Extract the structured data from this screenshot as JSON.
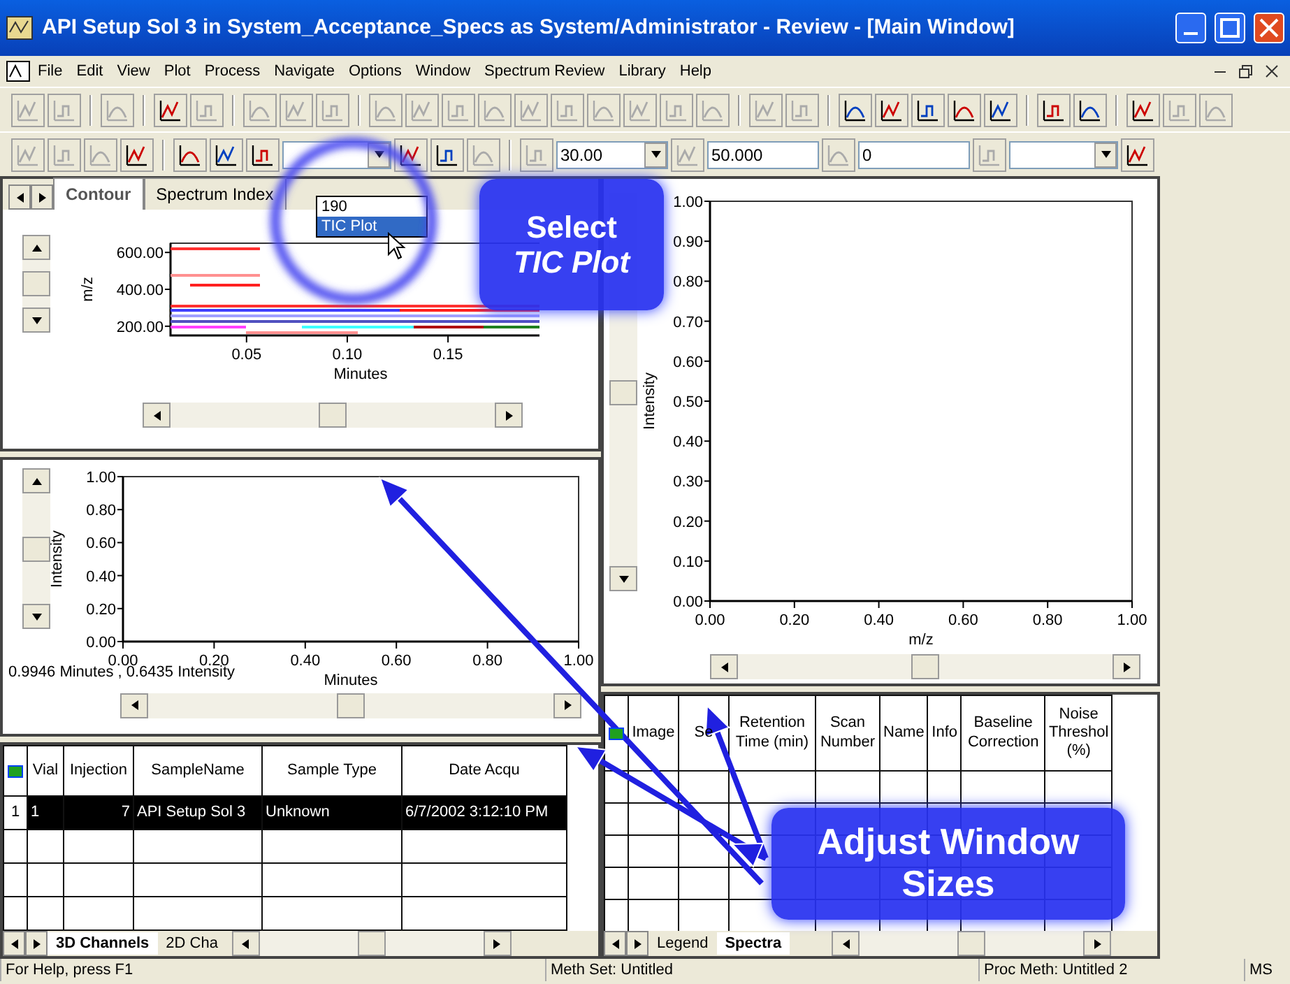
{
  "window": {
    "title": "API Setup Sol 3 in System_Acceptance_Specs as System/Administrator - Review - [Main Window]"
  },
  "menu": [
    "File",
    "Edit",
    "View",
    "Plot",
    "Process",
    "Navigate",
    "Options",
    "Window",
    "Spectrum Review",
    "Library",
    "Help"
  ],
  "toolbar_1": [
    [
      {
        "disabled": true
      },
      {
        "disabled": true
      }
    ],
    [
      {
        "disabled": true
      }
    ],
    [
      {
        "disabled": false
      },
      {
        "disabled": true
      }
    ],
    [
      {
        "disabled": true
      },
      {
        "disabled": true
      },
      {
        "disabled": true
      }
    ],
    [
      {
        "disabled": true
      },
      {
        "disabled": true
      },
      {
        "disabled": true
      },
      {
        "disabled": true
      },
      {
        "disabled": true
      },
      {
        "disabled": true
      },
      {
        "disabled": true
      },
      {
        "disabled": true
      },
      {
        "disabled": true
      },
      {
        "disabled": true
      }
    ],
    [
      {
        "disabled": true
      },
      {
        "disabled": true
      }
    ],
    [
      {
        "disabled": false
      },
      {
        "disabled": false
      },
      {
        "disabled": false
      },
      {
        "disabled": false
      },
      {
        "disabled": false
      }
    ],
    [
      {
        "disabled": false
      },
      {
        "disabled": false
      }
    ],
    [
      {
        "disabled": false
      },
      {
        "disabled": true
      },
      {
        "disabled": true
      }
    ]
  ],
  "toolbar_2": [
    {
      "kind": "icon",
      "disabled": true
    },
    {
      "kind": "icon",
      "disabled": true
    },
    {
      "kind": "icon",
      "disabled": true
    },
    {
      "kind": "icon",
      "disabled": false
    },
    {
      "kind": "sep"
    },
    {
      "kind": "icon",
      "disabled": false
    },
    {
      "kind": "icon",
      "disabled": false
    },
    {
      "kind": "icon",
      "disabled": false
    },
    {
      "kind": "combo"
    },
    {
      "kind": "icon",
      "disabled": false
    },
    {
      "kind": "icon",
      "disabled": false
    },
    {
      "kind": "icon",
      "disabled": true
    },
    {
      "kind": "sep"
    },
    {
      "kind": "icon",
      "disabled": true
    },
    {
      "kind": "combo",
      "value": "30.00"
    },
    {
      "kind": "icon",
      "disabled": true
    },
    {
      "kind": "field",
      "value": "50.000"
    },
    {
      "kind": "icon",
      "disabled": true
    },
    {
      "kind": "field",
      "value": "0"
    },
    {
      "kind": "icon",
      "disabled": true
    },
    {
      "kind": "combo"
    },
    {
      "kind": "icon",
      "disabled": false
    }
  ],
  "dropdown": {
    "options": [
      {
        "label": "190",
        "selected": false
      },
      {
        "label": "TIC Plot",
        "selected": true
      }
    ]
  },
  "contour_panel": {
    "tabs": [
      {
        "label": "Contour",
        "selected": true
      },
      {
        "label": "Spectrum Index",
        "selected": false
      }
    ],
    "plot": {
      "y_label": "m/z",
      "x_label": "Minutes",
      "y_ticks": [
        "600.00",
        "400.00",
        "200.00"
      ],
      "x_ticks": [
        "0.05",
        "0.10",
        "0.15"
      ]
    }
  },
  "tic_panel": {
    "plot": {
      "y_label": "Intensity",
      "x_label": "Minutes",
      "y_ticks": [
        "1.00",
        "0.80",
        "0.60",
        "0.40",
        "0.20",
        "0.00"
      ],
      "x_ticks": [
        "0.00",
        "0.20",
        "0.40",
        "0.60",
        "0.80",
        "1.00"
      ]
    },
    "readout": "0.9946 Minutes , 0.6435 Intensity"
  },
  "sample_table": {
    "columns": [
      "Vial",
      "Injection",
      "SampleName",
      "Sample Type",
      "Date Acqu"
    ],
    "rows": [
      {
        "row_header": "1",
        "cells": [
          "1",
          "7",
          "API Setup Sol 3",
          "Unknown",
          "6/7/2002 3:12:10 PM"
        ],
        "selected": true
      }
    ],
    "tabs": [
      {
        "label": "3D Channels",
        "selected": true
      },
      {
        "label": "2D Cha",
        "selected": false
      }
    ]
  },
  "spectrum_panel": {
    "plot": {
      "y_label": "Intensity",
      "x_label": "m/z",
      "y_ticks": [
        "1.00",
        "0.90",
        "0.80",
        "0.70",
        "0.60",
        "0.50",
        "0.40",
        "0.30",
        "0.20",
        "0.10",
        "0.00"
      ],
      "x_ticks": [
        "0.00",
        "0.20",
        "0.40",
        "0.60",
        "0.80",
        "1.00"
      ]
    }
  },
  "spectra_table": {
    "columns": [
      "Image",
      "Se",
      "Retention Time (min)",
      "Scan Number",
      "Name",
      "Info",
      "Baseline Correction",
      "Noise Threshol (%)"
    ],
    "tabs": [
      {
        "label": "Legend",
        "selected": false
      },
      {
        "label": "Spectra",
        "selected": true
      }
    ]
  },
  "status_bar": [
    "For Help, press F1",
    "Meth Set: Untitled",
    "Proc Meth: Untitled 2",
    "MS"
  ],
  "callouts": [
    {
      "lines": [
        "Select",
        "*TIC Plot*"
      ]
    },
    {
      "lines": [
        "Adjust Window",
        "Sizes"
      ]
    }
  ]
}
